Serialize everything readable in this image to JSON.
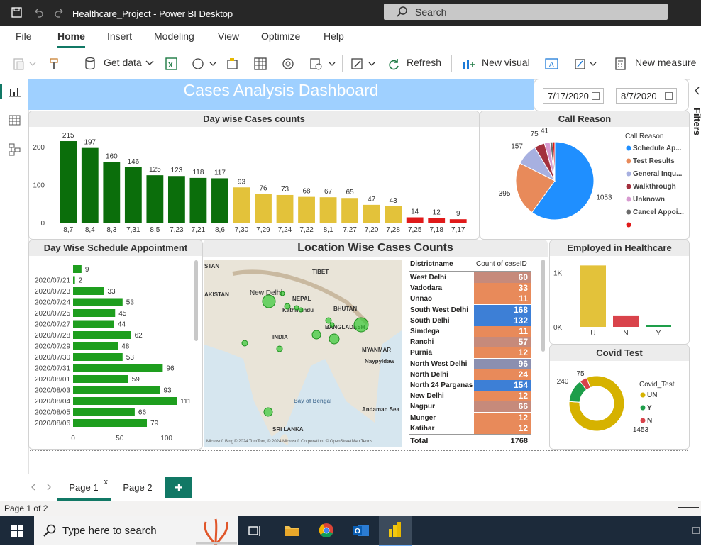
{
  "app": {
    "title": "Healthcare_Project - Power BI Desktop",
    "search_placeholder": "Search"
  },
  "menu": [
    "File",
    "Home",
    "Insert",
    "Modeling",
    "View",
    "Optimize",
    "Help"
  ],
  "ribbon": {
    "get_data": "Get data",
    "refresh": "Refresh",
    "new_visual": "New visual",
    "new_measure": "New measure"
  },
  "dashboard": {
    "title": "Cases Analysis Dashboard",
    "date_from": "7/17/2020",
    "date_to": "8/7/2020"
  },
  "filters_label": "Filters",
  "pages": {
    "page1": "Page 1",
    "page2": "Page 2",
    "close": "x",
    "add": "+"
  },
  "status": "Page 1 of 2",
  "taskbar": {
    "search_placeholder": "Type here to search"
  },
  "colors": {
    "green": "#0b6e0b",
    "yellow": "#e3c23a",
    "red": "#e01a1a",
    "blue": "#1f8fff",
    "orange": "#e88a5a",
    "teal": "#117865"
  },
  "chart_data": [
    {
      "type": "bar",
      "title": "Day wise Cases counts",
      "categories": [
        "8,7",
        "8,4",
        "8,3",
        "7,31",
        "8,5",
        "7,23",
        "7,21",
        "8,6",
        "7,30",
        "7,29",
        "7,24",
        "7,22",
        "8,1",
        "7,27",
        "7,20",
        "7,28",
        "7,25",
        "7,18",
        "7,17"
      ],
      "values": [
        215,
        197,
        160,
        146,
        125,
        123,
        118,
        117,
        93,
        76,
        73,
        68,
        67,
        65,
        47,
        43,
        14,
        12,
        9
      ],
      "colors": [
        "#0b6e0b",
        "#0b6e0b",
        "#0b6e0b",
        "#0b6e0b",
        "#0b6e0b",
        "#0b6e0b",
        "#0b6e0b",
        "#0b6e0b",
        "#e3c23a",
        "#e3c23a",
        "#e3c23a",
        "#e3c23a",
        "#e3c23a",
        "#e3c23a",
        "#e3c23a",
        "#e3c23a",
        "#e01a1a",
        "#e01a1a",
        "#e01a1a"
      ],
      "yticks": [
        0,
        100,
        200
      ],
      "ylim": [
        0,
        230
      ]
    },
    {
      "type": "pie",
      "title": "Call Reason",
      "legend_title": "Call Reason",
      "slices": [
        {
          "name": "Schedule Ap...",
          "value": 1053,
          "color": "#1f8fff"
        },
        {
          "name": "Test Results",
          "value": 395,
          "color": "#e88a5a"
        },
        {
          "name": "General Inqu...",
          "value": 157,
          "color": "#a7b0e0"
        },
        {
          "name": "Walkthrough",
          "value": 75,
          "color": "#a3303d"
        },
        {
          "name": "Unknown",
          "value": 41,
          "color": "#d79ad0"
        },
        {
          "name": "Cancel Appoi...",
          "value": 20,
          "color": "#6b6b6b"
        },
        {
          "name": "",
          "value": 15,
          "color": "#e01a1a"
        }
      ],
      "labels": [
        "1053",
        "395",
        "157",
        "75",
        "41"
      ]
    },
    {
      "type": "bar",
      "orientation": "horizontal",
      "title": "Day Wise Schedule Appointment",
      "categories": [
        "",
        "2020/07/21",
        "2020/07/23",
        "2020/07/24",
        "2020/07/25",
        "2020/07/27",
        "2020/07/28",
        "2020/07/29",
        "2020/07/30",
        "2020/07/31",
        "2020/08/01",
        "2020/08/03",
        "2020/08/04",
        "2020/08/05",
        "2020/08/06"
      ],
      "values": [
        9,
        2,
        33,
        53,
        45,
        44,
        62,
        48,
        53,
        96,
        59,
        93,
        111,
        66,
        79
      ],
      "xticks": [
        0,
        50,
        100
      ],
      "xlim": [
        0,
        120
      ]
    },
    {
      "type": "table",
      "title": "Location Wise Cases Counts",
      "columns": [
        "Districtname",
        "Count of caseID"
      ],
      "rows": [
        [
          "West Delhi",
          60
        ],
        [
          "Vadodara",
          33
        ],
        [
          "Unnao",
          11
        ],
        [
          "South West Delhi",
          168
        ],
        [
          "South Delhi",
          132
        ],
        [
          "Simdega",
          11
        ],
        [
          "Ranchi",
          57
        ],
        [
          "Purnia",
          12
        ],
        [
          "North West Delhi",
          96
        ],
        [
          "North Delhi",
          24
        ],
        [
          "North 24 Parganas",
          154
        ],
        [
          "New Delhi",
          12
        ],
        [
          "Nagpur",
          66
        ],
        [
          "Munger",
          12
        ],
        [
          "Katihar",
          12
        ]
      ],
      "total_label": "Total",
      "total": 1768
    },
    {
      "type": "bar",
      "title": "Employed in Healthcare",
      "categories": [
        "U",
        "N",
        "Y"
      ],
      "values": [
        1130,
        210,
        30
      ],
      "colors": [
        "#e3c23a",
        "#d9434b",
        "#1e9e4a"
      ],
      "ytick_labels": [
        "0K",
        "1K"
      ],
      "ylim": [
        0,
        1200
      ]
    },
    {
      "type": "pie",
      "donut": true,
      "title": "Covid Test",
      "legend_title": "Covid_Test",
      "slices": [
        {
          "name": "UN",
          "value": 1453,
          "color": "#d6b200"
        },
        {
          "name": "Y",
          "value": 240,
          "color": "#1e9e4a"
        },
        {
          "name": "N",
          "value": 75,
          "color": "#d9434b"
        }
      ]
    }
  ],
  "map": {
    "labels": [
      "STAN",
      "AKISTAN",
      "New Delhi",
      "NEPAL",
      "Kathmandu",
      "TIBET",
      "BHUTAN",
      "INDIA",
      "BANGLADESH",
      "MYANMAR",
      "Naypyidaw",
      "Bay of Bengal",
      "Andaman Sea",
      "SRI LANKA"
    ],
    "attribution": "© 2024 TomTom, © 2024 Microsoft Corporation, © OpenStreetMap  Terms",
    "ms_logo": "Microsoft Bing"
  }
}
